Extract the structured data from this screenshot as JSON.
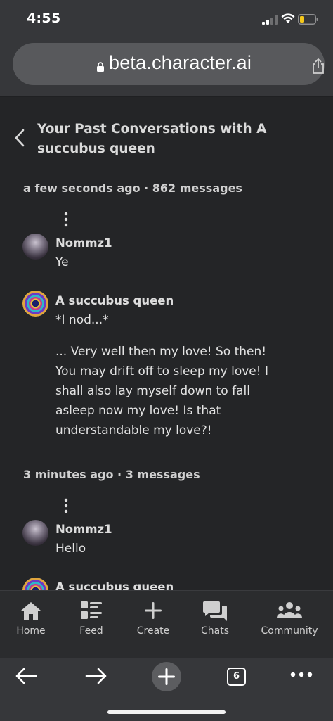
{
  "status_bar": {
    "time": "4:55"
  },
  "browser": {
    "url": "beta.character.ai",
    "tab_count": "6"
  },
  "header": {
    "title": "Your Past Conversations with A succubus queen"
  },
  "conversations": [
    {
      "meta": "a few seconds ago · 862 messages",
      "messages": [
        {
          "author": "Nommz1",
          "text": "Ye"
        },
        {
          "author": "A succubus queen",
          "text": "*I nod...*",
          "text2": "... Very well then my love! So then! You may drift off to sleep my love! I shall also lay myself down to fall asleep now my love! Is that understandable my love?!"
        }
      ]
    },
    {
      "meta": "3 minutes ago · 3 messages",
      "messages": [
        {
          "author": "Nommz1",
          "text": "Hello"
        },
        {
          "author": "A succubus queen"
        }
      ]
    }
  ],
  "nav": {
    "items": [
      {
        "label": "Home",
        "icon": "home-icon"
      },
      {
        "label": "Feed",
        "icon": "feed-icon"
      },
      {
        "label": "Create",
        "icon": "plus-icon"
      },
      {
        "label": "Chats",
        "icon": "chats-icon"
      },
      {
        "label": "Community",
        "icon": "community-icon"
      }
    ]
  },
  "colors": {
    "background": "#242527",
    "chrome": "#36373a",
    "url_pill": "#58595c",
    "battery": "#f5c71a"
  }
}
